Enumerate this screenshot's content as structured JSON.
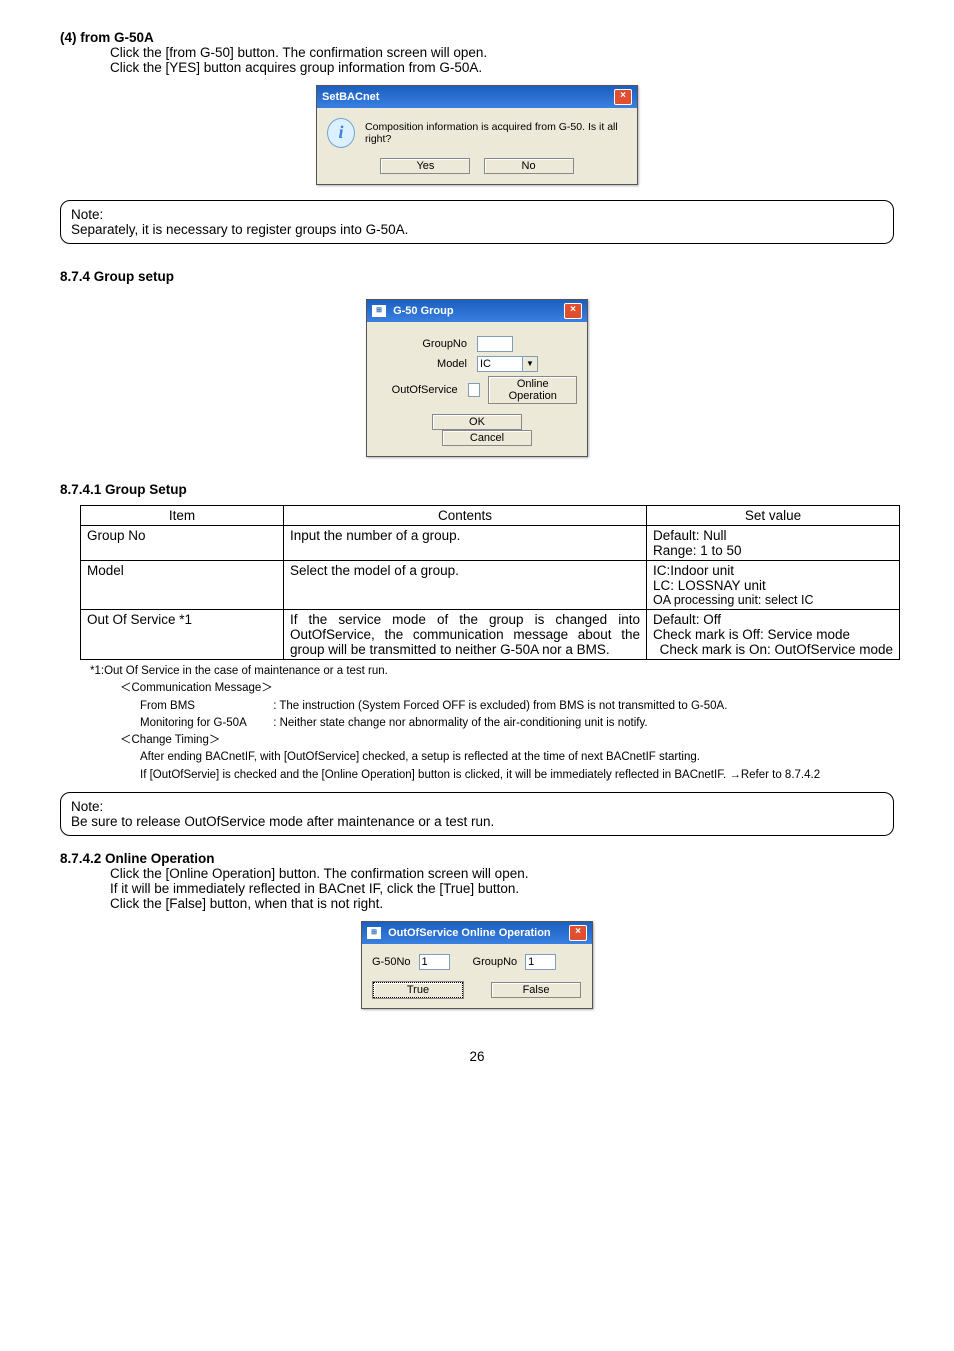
{
  "s4": {
    "heading": "(4) from G-50A",
    "line1": "Click the [from G-50] button. The confirmation screen will open.",
    "line2": "Click the [YES] button acquires group information from G-50A.",
    "dialog": {
      "title": "SetBACnet",
      "message": "Composition information is acquired from G-50. Is it all right?",
      "yes": "Yes",
      "no": "No"
    },
    "note_heading": "Note:",
    "note_text": "Separately, it is necessary to register groups into G-50A."
  },
  "s874": {
    "heading": "8.7.4 Group setup",
    "dialog": {
      "title": "G-50 Group",
      "group_no_label": "GroupNo",
      "model_label": "Model",
      "model_value": "IC",
      "oos_label": "OutOfService",
      "online_btn": "Online Operation",
      "ok": "OK",
      "cancel": "Cancel"
    }
  },
  "s8741": {
    "heading": "8.7.4.1 Group Setup",
    "table": {
      "h1": "Item",
      "h2": "Contents",
      "h3": "Set value",
      "r1": {
        "item": "Group No",
        "contents": "Input the number of a group.",
        "set1": "Default: Null",
        "set2": "Range: 1 to 50"
      },
      "r2": {
        "item": "Model",
        "contents": "Select the model of a group.",
        "set1": "IC:Indoor unit",
        "set2": "LC: LOSSNAY unit",
        "set3": "OA processing unit: select IC"
      },
      "r3": {
        "item": "Out Of Service *1",
        "contents": "If the service mode of the group is changed into OutOfService, the communication message about the group will be transmitted to neither G-50A nor a BMS.",
        "set1": "Default: Off",
        "set2": "Check mark is Off: Service mode",
        "set3": "Check mark is On: OutOfService mode"
      }
    },
    "footnotes": {
      "l1": "*1:Out Of Service in the case of maintenance or a test run.",
      "l2": "＜Communication Message＞",
      "from_bms_label": "From BMS",
      "from_bms_text": ": The instruction (System Forced OFF is excluded) from BMS is not transmitted to G-50A.",
      "monitor_label": "Monitoring for G-50A",
      "monitor_text": ": Neither state change nor abnormality of the air-conditioning unit is notify.",
      "l3": "＜Change Timing＞",
      "ct1": "After ending BACnetIF, with [OutOfService] checked, a setup is reflected at the time of next BACnetIF starting.",
      "ct2": "If [OutOfServie] is checked and the [Online Operation] button is clicked, it will be immediately reflected in BACnetIF.  →Refer to 8.7.4.2"
    },
    "note_heading": "Note:",
    "note_text": "Be sure to release OutOfService mode after maintenance or a test run."
  },
  "s8742": {
    "heading": "8.7.4.2 Online Operation",
    "line1": "Click the [Online Operation] button. The confirmation screen will open.",
    "line2": "If it will be immediately reflected in BACnet IF, click the [True] button.",
    "line3": "Click the [False] button, when that is not right.",
    "dialog": {
      "title": "OutOfService Online Operation",
      "g50no_label": "G-50No",
      "g50no_value": "1",
      "groupno_label": "GroupNo",
      "groupno_value": "1",
      "true_btn": "True",
      "false_btn": "False"
    }
  },
  "page": "26"
}
